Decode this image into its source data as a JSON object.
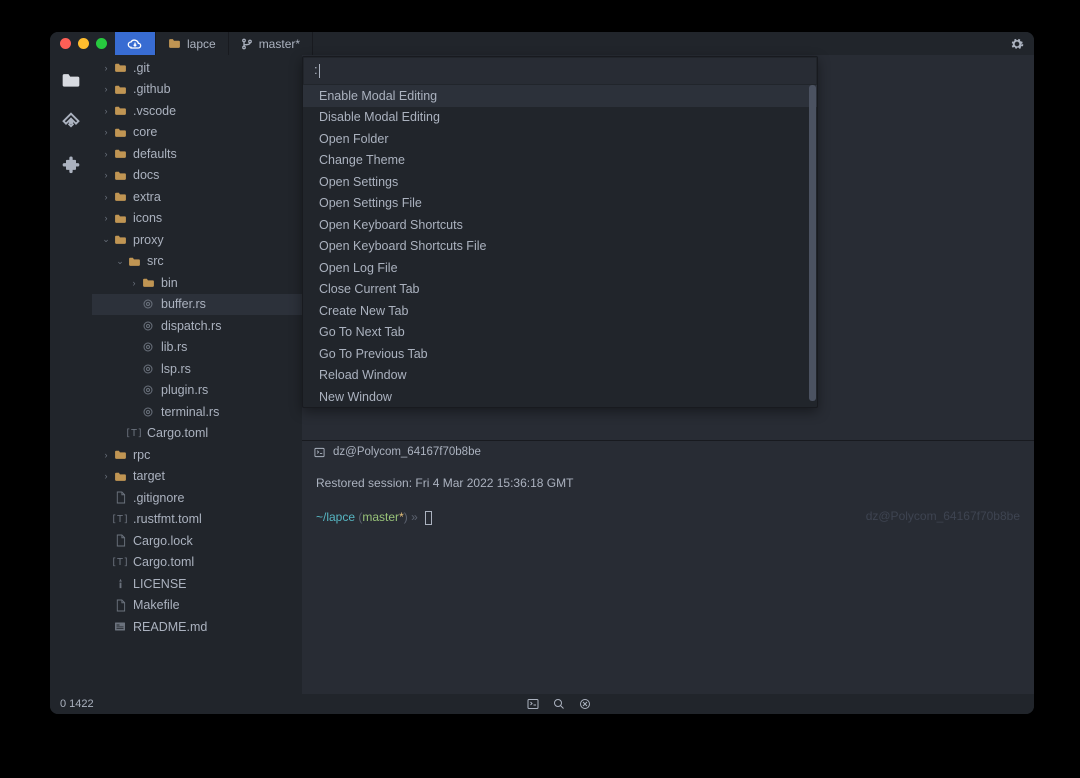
{
  "titlebar": {
    "tabs": [
      {
        "label": "",
        "icon": "cloud-workspace-icon",
        "active": true
      },
      {
        "label": "lapce",
        "icon": "folder-icon"
      },
      {
        "label": "master*",
        "icon": "git-branch-icon"
      }
    ]
  },
  "activitybar": {
    "items": [
      "explorer-icon",
      "source-control-icon",
      "extensions-icon"
    ]
  },
  "file_tree": [
    {
      "depth": 0,
      "chev": ">",
      "icon": "folder",
      "label": ".git"
    },
    {
      "depth": 0,
      "chev": ">",
      "icon": "folder",
      "label": ".github"
    },
    {
      "depth": 0,
      "chev": ">",
      "icon": "folder",
      "label": ".vscode"
    },
    {
      "depth": 0,
      "chev": ">",
      "icon": "folder",
      "label": "core"
    },
    {
      "depth": 0,
      "chev": ">",
      "icon": "folder",
      "label": "defaults"
    },
    {
      "depth": 0,
      "chev": ">",
      "icon": "folder",
      "label": "docs"
    },
    {
      "depth": 0,
      "chev": ">",
      "icon": "folder",
      "label": "extra"
    },
    {
      "depth": 0,
      "chev": ">",
      "icon": "folder",
      "label": "icons"
    },
    {
      "depth": 0,
      "chev": "v",
      "icon": "folder",
      "label": "proxy"
    },
    {
      "depth": 1,
      "chev": "v",
      "icon": "folder",
      "label": "src"
    },
    {
      "depth": 2,
      "chev": ">",
      "icon": "folder",
      "label": "bin"
    },
    {
      "depth": 2,
      "chev": "",
      "icon": "rust",
      "label": "buffer.rs",
      "selected": true
    },
    {
      "depth": 2,
      "chev": "",
      "icon": "rust",
      "label": "dispatch.rs"
    },
    {
      "depth": 2,
      "chev": "",
      "icon": "rust",
      "label": "lib.rs"
    },
    {
      "depth": 2,
      "chev": "",
      "icon": "rust",
      "label": "lsp.rs"
    },
    {
      "depth": 2,
      "chev": "",
      "icon": "rust",
      "label": "plugin.rs"
    },
    {
      "depth": 2,
      "chev": "",
      "icon": "rust",
      "label": "terminal.rs"
    },
    {
      "depth": 1,
      "chev": "",
      "icon": "toml",
      "label": "Cargo.toml"
    },
    {
      "depth": 0,
      "chev": ">",
      "icon": "folder",
      "label": "rpc"
    },
    {
      "depth": 0,
      "chev": ">",
      "icon": "folder",
      "label": "target"
    },
    {
      "depth": 0,
      "chev": "",
      "icon": "file",
      "label": ".gitignore"
    },
    {
      "depth": 0,
      "chev": "",
      "icon": "toml",
      "label": ".rustfmt.toml"
    },
    {
      "depth": 0,
      "chev": "",
      "icon": "file",
      "label": "Cargo.lock"
    },
    {
      "depth": 0,
      "chev": "",
      "icon": "toml",
      "label": "Cargo.toml"
    },
    {
      "depth": 0,
      "chev": "",
      "icon": "license",
      "label": "LICENSE"
    },
    {
      "depth": 0,
      "chev": "",
      "icon": "file",
      "label": "Makefile"
    },
    {
      "depth": 0,
      "chev": "",
      "icon": "readme",
      "label": "README.md"
    }
  ],
  "palette": {
    "input": ":",
    "items": [
      "Enable Modal Editing",
      "Disable Modal Editing",
      "Open Folder",
      "Change Theme",
      "Open Settings",
      "Open Settings File",
      "Open Keyboard Shortcuts",
      "Open Keyboard Shortcuts File",
      "Open Log File",
      "Close Current Tab",
      "Create New Tab",
      "Go To Next Tab",
      "Go To Previous Tab",
      "Reload Window",
      "New Window"
    ]
  },
  "terminal": {
    "header": "dz@Polycom_64167f70b8be",
    "restored": "Restored session: Fri  4 Mar 2022 15:36:18 GMT",
    "prompt_path": "~/lapce",
    "prompt_branch": "master",
    "prompt_star": "*",
    "right_label": "dz@Polycom_64167f70b8be"
  },
  "statusbar": {
    "left": "0  1422"
  }
}
